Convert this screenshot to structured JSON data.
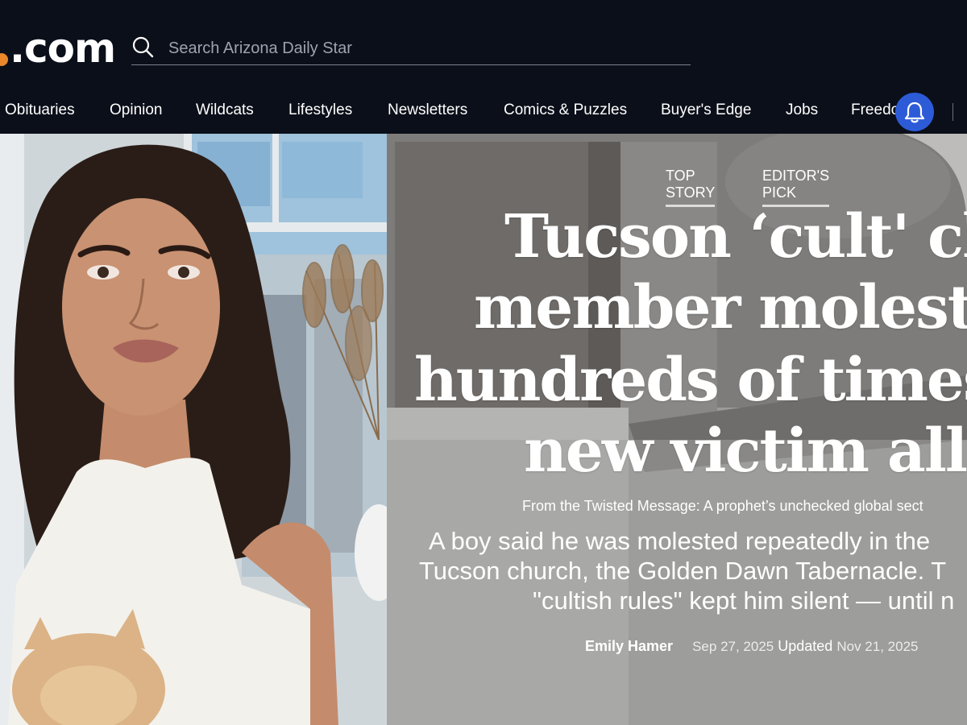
{
  "header": {
    "logo_text": ".com",
    "search": {
      "placeholder": "Search Arizona Daily Star",
      "value": ""
    },
    "nav": [
      "Obituaries",
      "Opinion",
      "Wildcats",
      "Lifestyles",
      "Newsletters",
      "Comics & Puzzles",
      "Buyer's Edge",
      "Jobs",
      "Freedo"
    ],
    "notification_icon": "bell-icon"
  },
  "colors": {
    "header_bg": "#0b0f19",
    "bell_bg": "#2d5bd8",
    "logo_dot": "#e9872a"
  },
  "article": {
    "tags": [
      "TOP STORY",
      "EDITOR'S PICK"
    ],
    "headline_lines": [
      "Tucson ‘cult' chur",
      "member molested l",
      "hundreds of times in",
      "new victim allege"
    ],
    "series": "From the Twisted Message: A prophet’s unchecked global sect",
    "dek_lines": [
      "A boy said he was molested repeatedly in the",
      "Tucson church, the Golden Dawn Tabernacle. T",
      "\"cultish rules\" kept him silent — until n"
    ],
    "author": "Emily Hamer",
    "published": "Sep 27, 2025",
    "updated_label": "Updated",
    "updated": "Nov 21, 2025"
  }
}
